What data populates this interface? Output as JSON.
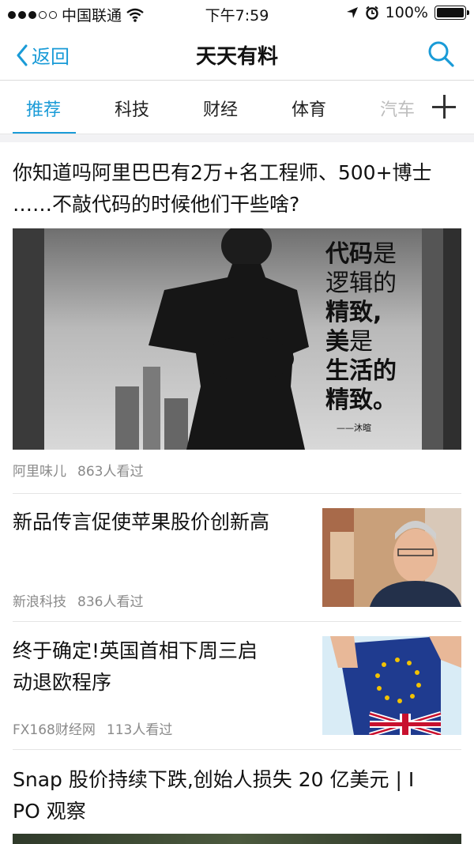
{
  "status_bar": {
    "carrier": "中国联通",
    "time": "下午7:59",
    "battery": "100%"
  },
  "nav": {
    "back_label": "返回",
    "title": "天天有料"
  },
  "tabs": [
    {
      "label": "推荐",
      "active": true
    },
    {
      "label": "科技"
    },
    {
      "label": "财经"
    },
    {
      "label": "体育"
    },
    {
      "label": "汽车"
    }
  ],
  "articles": [
    {
      "title_line1": "你知道吗阿里巴巴有2万+名工程师、500+博士",
      "title_line2": "……不敲代码的时候他们干些啥?",
      "image_quote": {
        "l1a": "代码",
        "l1b": "是",
        "l2": "逻辑的",
        "l3": "精致,",
        "l4a": "美",
        "l4b": "是",
        "l5": "生活的",
        "l6": "精致。",
        "sign": "——沐暄"
      },
      "source": "阿里味儿",
      "views": "863人看过"
    },
    {
      "title_line1": "新品传言促使苹果股价创新高",
      "source": "新浪科技",
      "views": "836人看过"
    },
    {
      "title_line1": "终于确定!英国首相下周三启",
      "title_line2": "动退欧程序",
      "source": "FX168财经网",
      "views": "113人看过"
    },
    {
      "title_line1": "Snap 股价持续下跌,创始人损失 20 亿美元 | I",
      "title_line2": "PO 观察"
    }
  ],
  "colors": {
    "accent": "#1a9bd7",
    "meta_text": "#8a8a8a"
  }
}
